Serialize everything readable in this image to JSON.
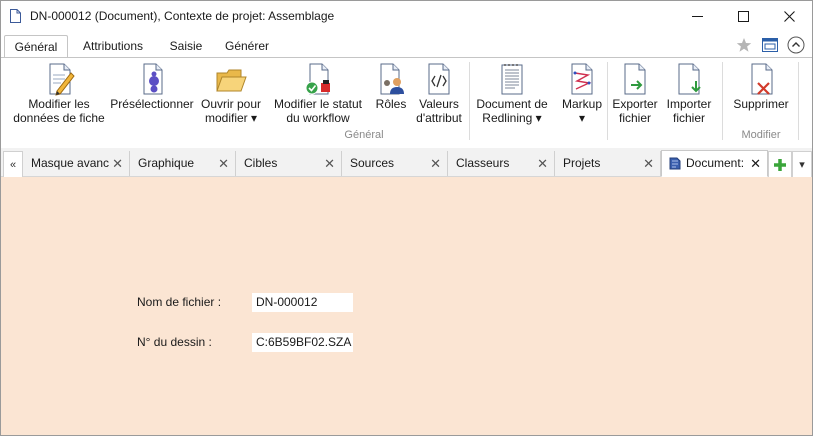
{
  "window": {
    "title": "DN-000012 (Document), Contexte de projet: Assemblage"
  },
  "ribbon_tabs": [
    {
      "label": "Général",
      "active": true
    },
    {
      "label": "Attributions",
      "active": false
    },
    {
      "label": "Saisie",
      "active": false
    },
    {
      "label": "Générer",
      "active": false
    }
  ],
  "ribbon": {
    "general_group_label": "Général",
    "modifier_group_label": "Modifier",
    "buttons": [
      {
        "line1": "Modifier les",
        "line2": "données de fiche",
        "icon": "edit-record-icon"
      },
      {
        "line1": "Présélectionner",
        "line2": "",
        "icon": "preselect-icon"
      },
      {
        "line1": "Ouvrir pour",
        "line2": "modifier ▾",
        "icon": "open-folder-icon"
      },
      {
        "line1": "Modifier le statut",
        "line2": "du workflow",
        "icon": "workflow-status-icon"
      },
      {
        "line1": "Rôles",
        "line2": "",
        "icon": "roles-icon"
      },
      {
        "line1": "Valeurs",
        "line2": "d'attribut",
        "icon": "attribute-values-icon"
      },
      {
        "line1": "Document de",
        "line2": "Redlining ▾",
        "icon": "redlining-document-icon"
      },
      {
        "line1": "Markup",
        "line2": "▾",
        "icon": "markup-icon"
      },
      {
        "line1": "Exporter",
        "line2": "fichier",
        "icon": "export-file-icon"
      },
      {
        "line1": "Importer",
        "line2": "fichier",
        "icon": "import-file-icon"
      },
      {
        "line1": "Supprimer",
        "line2": "",
        "icon": "delete-icon"
      }
    ]
  },
  "doc_tabs": [
    {
      "label": "Masque avanc",
      "close": "✕"
    },
    {
      "label": "Graphique",
      "close": "✕"
    },
    {
      "label": "Cibles",
      "close": "✕"
    },
    {
      "label": "Sources",
      "close": "✕"
    },
    {
      "label": "Classeurs",
      "close": "✕"
    },
    {
      "label": "Projets",
      "close": "✕"
    },
    {
      "label": "Document:",
      "close": "✕",
      "active": true
    }
  ],
  "doc_tab_nav": {
    "scroll_left": "«",
    "menu": "▾"
  },
  "form": {
    "filename_label": "Nom de fichier :",
    "filename_value": "DN-000012",
    "drawing_label": "N° du dessin :",
    "drawing_value": "C:6B59BF02.SZA"
  },
  "colors": {
    "content_background": "#fbe5d3",
    "add_tab_green": "#3aa53a",
    "delete_red": "#d23a2a"
  }
}
